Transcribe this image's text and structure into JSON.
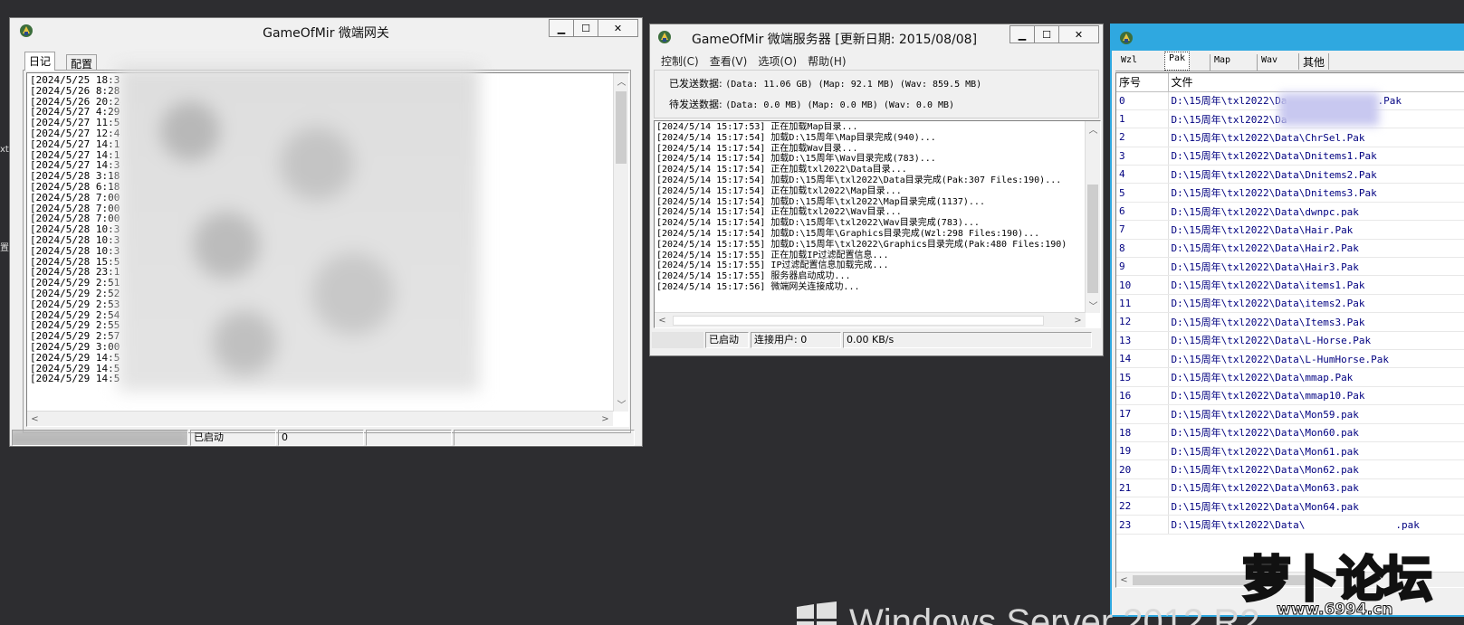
{
  "gateway": {
    "title": "GameOfMir 微端网关",
    "tabs": [
      "日记",
      "配置"
    ],
    "log": [
      "[2024/5/25 18:35:",
      "[2024/5/26 8:28:5",
      "[2024/5/26 20:24:",
      "[2024/5/27 4:29:3",
      "[2024/5/27 11:51:",
      "[2024/5/27 12:43:",
      "[2024/5/27 14:12:",
      "[2024/5/27 14:12:",
      "[2024/5/27 14:32:",
      "[2024/5/28 3:18:5",
      "[2024/5/28 6:18:0",
      "[2024/5/28 7:00:5",
      "[2024/5/28 7:00:5",
      "[2024/5/28 7:00:5",
      "[2024/5/28 10:31:",
      "[2024/5/28 10:31:",
      "[2024/5/28 10:31:",
      "[2024/5/28 15:55:",
      "[2024/5/28 23:16:",
      "[2024/5/29 2:51:1",
      "[2024/5/29 2:52:1",
      "[2024/5/29 2:53:1",
      "[2024/5/29 2:54:1",
      "[2024/5/29 2:55:1",
      "[2024/5/29 2:57:1",
      "[2024/5/29 3:00:1",
      "[2024/5/29 14:54:",
      "[2024/5/29 14:56:",
      "[2024/5/29 14:57:"
    ],
    "status": [
      "",
      "已启动",
      "0",
      "",
      ""
    ]
  },
  "server": {
    "title": "GameOfMir 微端服务器 [更新日期: 2015/08/08]",
    "menu": [
      "控制(C)",
      "查看(V)",
      "选项(O)",
      "帮助(H)"
    ],
    "sent_label": "已发送数据:",
    "sent_value": "(Data: 11.06 GB) (Map: 92.1 MB) (Wav: 859.5 MB)",
    "pending_label": "待发送数据:",
    "pending_value": "(Data: 0.0 MB) (Map: 0.0 MB) (Wav: 0.0 MB)",
    "log": [
      "[2024/5/14 15:17:53] 正在加载Map目录...",
      "[2024/5/14 15:17:54] 加载D:\\15周年\\Map目录完成(940)...",
      "[2024/5/14 15:17:54] 正在加载Wav目录...",
      "[2024/5/14 15:17:54] 加载D:\\15周年\\Wav目录完成(783)...",
      "[2024/5/14 15:17:54] 正在加载txl2022\\Data目录...",
      "[2024/5/14 15:17:54] 加载D:\\15周年\\txl2022\\Data目录完成(Pak:307 Files:190)...",
      "[2024/5/14 15:17:54] 正在加载txl2022\\Map目录...",
      "[2024/5/14 15:17:54] 加载D:\\15周年\\txl2022\\Map目录完成(1137)...",
      "[2024/5/14 15:17:54] 正在加载txl2022\\Wav目录...",
      "[2024/5/14 15:17:54] 加载D:\\15周年\\txl2022\\Wav目录完成(783)...",
      "[2024/5/14 15:17:54] 加载D:\\15周年\\Graphics目录完成(Wzl:298 Files:190)...",
      "[2024/5/14 15:17:55] 加载D:\\15周年\\txl2022\\Graphics目录完成(Pak:480 Files:190)",
      "[2024/5/14 15:17:55] 正在加载IP过滤配置信息...",
      "[2024/5/14 15:17:55] IP过滤配置信息加载完成...",
      "[2024/5/14 15:17:55] 服务器启动成功...",
      "[2024/5/14 15:17:56] 微端网关连接成功..."
    ],
    "status": [
      "",
      "已启动",
      "连接用户: 0",
      "0.00 KB/s"
    ]
  },
  "files": {
    "tabs": [
      "Wzl",
      "Pak",
      "Map",
      "Wav",
      "其他"
    ],
    "col_index": "序号",
    "col_file": "文件",
    "rows": [
      [
        "0",
        "D:\\15周年\\txl2022\\Da",
        ".Pak"
      ],
      [
        "1",
        "D:\\15周年\\txl2022\\Da",
        ""
      ],
      [
        "2",
        "D:\\15周年\\txl2022\\Data\\ChrSel.Pak",
        ""
      ],
      [
        "3",
        "D:\\15周年\\txl2022\\Data\\Dnitems1.Pak",
        ""
      ],
      [
        "4",
        "D:\\15周年\\txl2022\\Data\\Dnitems2.Pak",
        ""
      ],
      [
        "5",
        "D:\\15周年\\txl2022\\Data\\Dnitems3.Pak",
        ""
      ],
      [
        "6",
        "D:\\15周年\\txl2022\\Data\\dwnpc.pak",
        ""
      ],
      [
        "7",
        "D:\\15周年\\txl2022\\Data\\Hair.Pak",
        ""
      ],
      [
        "8",
        "D:\\15周年\\txl2022\\Data\\Hair2.Pak",
        ""
      ],
      [
        "9",
        "D:\\15周年\\txl2022\\Data\\Hair3.Pak",
        ""
      ],
      [
        "10",
        "D:\\15周年\\txl2022\\Data\\items1.Pak",
        ""
      ],
      [
        "11",
        "D:\\15周年\\txl2022\\Data\\items2.Pak",
        ""
      ],
      [
        "12",
        "D:\\15周年\\txl2022\\Data\\Items3.Pak",
        ""
      ],
      [
        "13",
        "D:\\15周年\\txl2022\\Data\\L-Horse.Pak",
        ""
      ],
      [
        "14",
        "D:\\15周年\\txl2022\\Data\\L-HumHorse.Pak",
        ""
      ],
      [
        "15",
        "D:\\15周年\\txl2022\\Data\\mmap.Pak",
        ""
      ],
      [
        "16",
        "D:\\15周年\\txl2022\\Data\\mmap10.Pak",
        ""
      ],
      [
        "17",
        "D:\\15周年\\txl2022\\Data\\Mon59.pak",
        ""
      ],
      [
        "18",
        "D:\\15周年\\txl2022\\Data\\Mon60.pak",
        ""
      ],
      [
        "19",
        "D:\\15周年\\txl2022\\Data\\Mon61.pak",
        ""
      ],
      [
        "20",
        "D:\\15周年\\txl2022\\Data\\Mon62.pak",
        ""
      ],
      [
        "21",
        "D:\\15周年\\txl2022\\Data\\Mon63.pak",
        ""
      ],
      [
        "22",
        "D:\\15周年\\txl2022\\Data\\Mon64.pak",
        ""
      ],
      [
        "23",
        "D:\\15周年\\txl2022\\Data\\",
        ".pak"
      ]
    ]
  },
  "desktop": {
    "edge_labels": [
      "xt",
      "置"
    ],
    "os_logo_text": "Windows Server 2012 R2"
  },
  "watermark": {
    "brand": "萝卜论坛",
    "url": "www.6994.cn"
  }
}
